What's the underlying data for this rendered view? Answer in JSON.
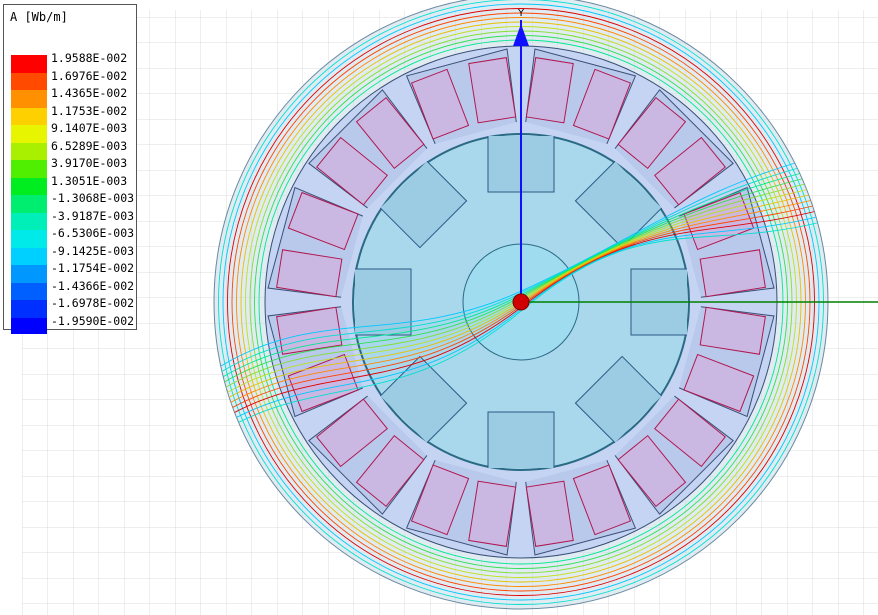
{
  "legend": {
    "title": "A [Wb/m]",
    "entries": [
      {
        "value": "1.9588E-002",
        "color": "#ff0000"
      },
      {
        "value": "1.6976E-002",
        "color": "#ff4a00"
      },
      {
        "value": "1.4365E-002",
        "color": "#ff9000"
      },
      {
        "value": "1.1753E-002",
        "color": "#ffd000"
      },
      {
        "value": "9.1407E-003",
        "color": "#e8f500"
      },
      {
        "value": "6.5289E-003",
        "color": "#a8f000"
      },
      {
        "value": "3.9170E-003",
        "color": "#50ee00"
      },
      {
        "value": "1.3051E-003",
        "color": "#00ee20"
      },
      {
        "value": "-1.3068E-003",
        "color": "#00ee70"
      },
      {
        "value": "-3.9187E-003",
        "color": "#00eeb8"
      },
      {
        "value": "-6.5306E-003",
        "color": "#00eaea"
      },
      {
        "value": "-9.1425E-003",
        "color": "#00d0ff"
      },
      {
        "value": "-1.1754E-002",
        "color": "#0098ff"
      },
      {
        "value": "-1.4366E-002",
        "color": "#0060ff"
      },
      {
        "value": "-1.6978E-002",
        "color": "#0030ff"
      },
      {
        "value": "-1.9590E-002",
        "color": "#0000ff"
      }
    ]
  },
  "axes": {
    "y_label": "Y"
  }
}
